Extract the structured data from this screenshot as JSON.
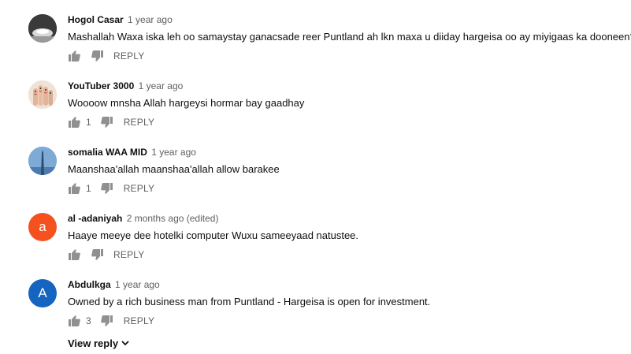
{
  "comments": [
    {
      "author": "Hogol Casar",
      "time": "1 year ago",
      "text": "Mashallah Waxa iska leh oo samaystay ganacsade reer Puntland ah lkn maxa u diiday hargeisa oo ay miyigaas ka dooneen?",
      "likes": "",
      "reply_label": "REPLY",
      "avatar": {
        "type": "image",
        "icon": "lamp-photo-avatar"
      }
    },
    {
      "author": "YouTuber 3000",
      "time": "1 year ago",
      "text": "Woooow mnsha Allah hargeysi hormar bay gaadhay",
      "likes": "1",
      "reply_label": "REPLY",
      "avatar": {
        "type": "image",
        "icon": "fingers-photo-avatar"
      }
    },
    {
      "author": "somalia WAA MID",
      "time": "1 year ago",
      "text": "Maanshaa'allah maanshaa'allah allow barakee",
      "likes": "1",
      "reply_label": "REPLY",
      "avatar": {
        "type": "image",
        "icon": "tower-photo-avatar"
      }
    },
    {
      "author": "al -adaniyah",
      "time": "2 months ago (edited)",
      "text": "Haaye meeye dee hotelki computer Wuxu sameeyaad natustee.",
      "likes": "",
      "reply_label": "REPLY",
      "avatar": {
        "type": "letter",
        "letter": "a",
        "color": "#f4511e"
      }
    },
    {
      "author": "Abdulkga",
      "time": "1 year ago",
      "text": "Owned by a rich business man from Puntland - Hargeisa is open for investment.",
      "likes": "3",
      "reply_label": "REPLY",
      "avatar": {
        "type": "letter",
        "letter": "A",
        "color": "#1565c0"
      }
    }
  ],
  "view_reply_label": "View reply",
  "colors": {
    "text": "#0f0f0f",
    "secondary": "#606060",
    "icon": "#909090"
  }
}
